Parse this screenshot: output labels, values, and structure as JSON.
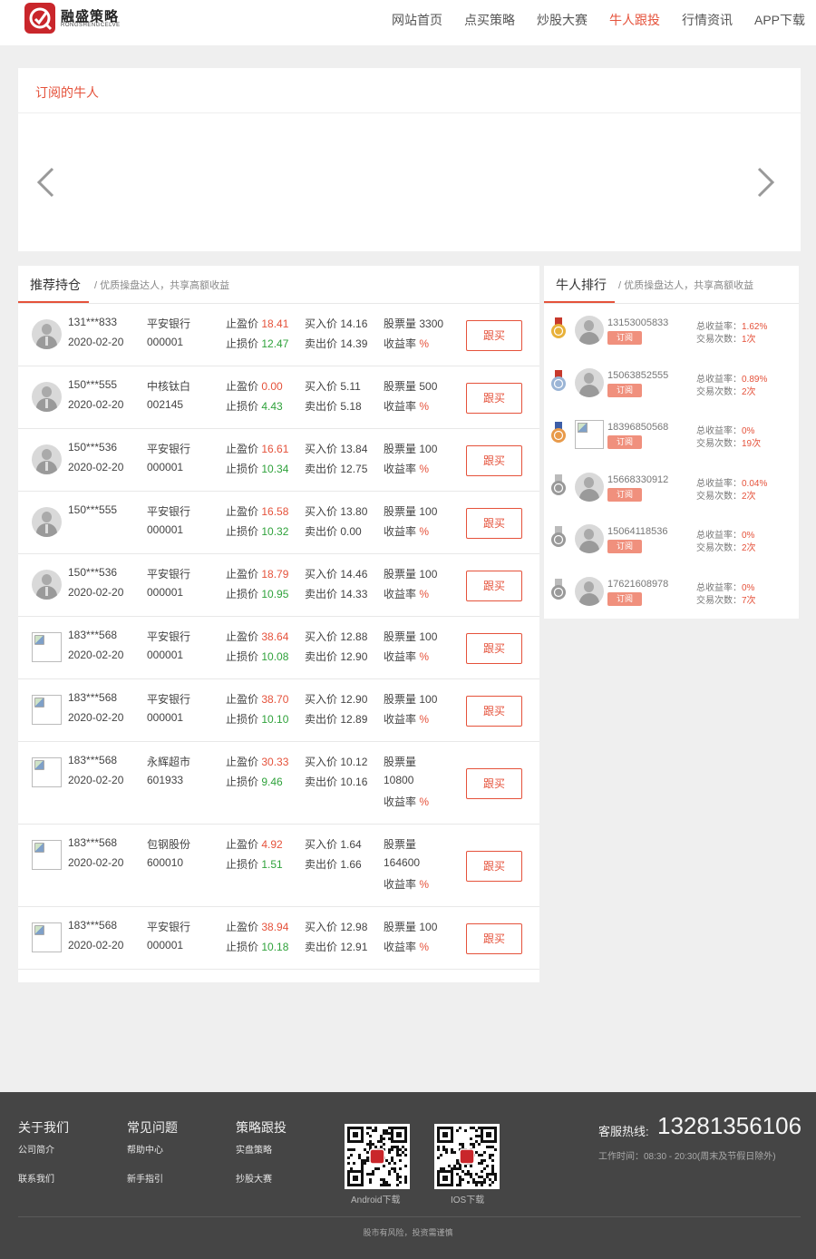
{
  "header": {
    "logo_text": "融盛策略",
    "logo_sub": "RONGSHENGCELVE",
    "nav": [
      "网站首页",
      "点买策略",
      "炒股大赛",
      "牛人跟投",
      "行情资讯",
      "APP下载"
    ],
    "active_nav": "牛人跟投",
    "accent_color": "#e5523b"
  },
  "subscribed": {
    "title": "订阅的牛人"
  },
  "recommend": {
    "title": "推荐持仓",
    "desc": "/ 优质操盘达人，共享高额收益",
    "labels": {
      "stop_profit": "止盈价",
      "stop_loss": "止损价",
      "buy": "买入价",
      "sell": "卖出价",
      "volume": "股票量",
      "yield": "收益率",
      "follow": "跟买"
    },
    "rows": [
      {
        "user": "131***833",
        "date": "2020-02-20",
        "stock": "平安银行",
        "code": "000001",
        "stop_profit": "18.41",
        "stop_loss": "12.47",
        "buy": "14.16",
        "sell": "14.39",
        "volume": "3300",
        "yield": "%",
        "avatar": "default"
      },
      {
        "user": "150***555",
        "date": "2020-02-20",
        "stock": "中核钛白",
        "code": "002145",
        "stop_profit": "0.00",
        "stop_loss": "4.43",
        "buy": "5.11",
        "sell": "5.18",
        "volume": "500",
        "yield": "%",
        "avatar": "default"
      },
      {
        "user": "150***536",
        "date": "2020-02-20",
        "stock": "平安银行",
        "code": "000001",
        "stop_profit": "16.61",
        "stop_loss": "10.34",
        "buy": "13.84",
        "sell": "12.75",
        "volume": "100",
        "yield": "%",
        "avatar": "default"
      },
      {
        "user": "150***555",
        "date": "",
        "stock": "平安银行",
        "code": "000001",
        "stop_profit": "16.58",
        "stop_loss": "10.32",
        "buy": "13.80",
        "sell": "0.00",
        "volume": "100",
        "yield": "%",
        "avatar": "default"
      },
      {
        "user": "150***536",
        "date": "2020-02-20",
        "stock": "平安银行",
        "code": "000001",
        "stop_profit": "18.79",
        "stop_loss": "10.95",
        "buy": "14.46",
        "sell": "14.33",
        "volume": "100",
        "yield": "%",
        "avatar": "default"
      },
      {
        "user": "183***568",
        "date": "2020-02-20",
        "stock": "平安银行",
        "code": "000001",
        "stop_profit": "38.64",
        "stop_loss": "10.08",
        "buy": "12.88",
        "sell": "12.90",
        "volume": "100",
        "yield": "%",
        "avatar": "broken"
      },
      {
        "user": "183***568",
        "date": "2020-02-20",
        "stock": "平安银行",
        "code": "000001",
        "stop_profit": "38.70",
        "stop_loss": "10.10",
        "buy": "12.90",
        "sell": "12.89",
        "volume": "100",
        "yield": "%",
        "avatar": "broken"
      },
      {
        "user": "183***568",
        "date": "2020-02-20",
        "stock": "永辉超市",
        "code": "601933",
        "stop_profit": "30.33",
        "stop_loss": "9.46",
        "buy": "10.12",
        "sell": "10.16",
        "volume": "10800",
        "yield": "%",
        "avatar": "broken",
        "wrap": true
      },
      {
        "user": "183***568",
        "date": "2020-02-20",
        "stock": "包钢股份",
        "code": "600010",
        "stop_profit": "4.92",
        "stop_loss": "1.51",
        "buy": "1.64",
        "sell": "1.66",
        "volume": "164600",
        "yield": "%",
        "avatar": "broken",
        "wrap": true
      },
      {
        "user": "183***568",
        "date": "2020-02-20",
        "stock": "平安银行",
        "code": "000001",
        "stop_profit": "38.94",
        "stop_loss": "10.18",
        "buy": "12.98",
        "sell": "12.91",
        "volume": "100",
        "yield": "%",
        "avatar": "broken"
      }
    ]
  },
  "ranking": {
    "title": "牛人排行",
    "desc": "/ 优质操盘达人，共享高额收益",
    "labels": {
      "yield": "总收益率：",
      "count": "交易次数：",
      "subscribe": "订阅"
    },
    "rows": [
      {
        "phone": "13153005833",
        "yield": "1.62%",
        "count": "1次",
        "medal": "gold",
        "avatar": "default"
      },
      {
        "phone": "15063852555",
        "yield": "0.89%",
        "count": "2次",
        "medal": "silver",
        "avatar": "default"
      },
      {
        "phone": "18396850568",
        "yield": "0%",
        "count": "19次",
        "medal": "bronze",
        "avatar": "broken"
      },
      {
        "phone": "15668330912",
        "yield": "0.04%",
        "count": "2次",
        "medal": "gray",
        "avatar": "default"
      },
      {
        "phone": "15064118536",
        "yield": "0%",
        "count": "2次",
        "medal": "gray",
        "avatar": "default"
      },
      {
        "phone": "17621608978",
        "yield": "0%",
        "count": "7次",
        "medal": "gray",
        "avatar": "default"
      }
    ]
  },
  "footer": {
    "columns": [
      {
        "title": "关于我们",
        "links": [
          "公司简介",
          "联系我们"
        ]
      },
      {
        "title": "常见问题",
        "links": [
          "帮助中心",
          "新手指引"
        ]
      },
      {
        "title": "策略跟投",
        "links": [
          "实盘策略",
          "抄股大赛"
        ]
      }
    ],
    "qr_android": "Android下载",
    "qr_ios": "IOS下载",
    "hotline_label": "客服热线:",
    "hotline": "13281356106",
    "work_time": "工作时间：08:30 - 20:30(周末及节假日除外)",
    "disclaimer": "股市有风险，投资需谨慎"
  }
}
